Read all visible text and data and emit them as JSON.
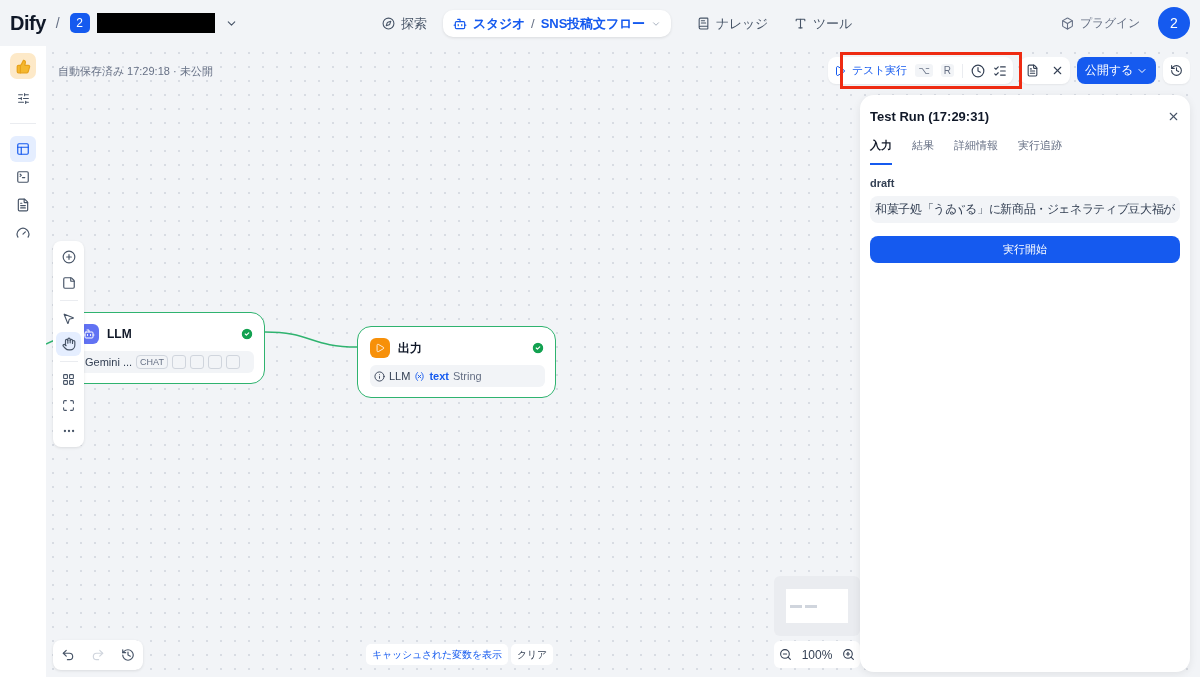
{
  "header": {
    "logo": "Dify",
    "separator": "/",
    "workspace_badge": "2",
    "nav": [
      {
        "label": "探索",
        "selected": false
      },
      {
        "label": "スタジオ",
        "selected": true,
        "separator": "/",
        "app": "SNS投稿文フロー"
      },
      {
        "label": "ナレッジ",
        "selected": false
      },
      {
        "label": "ツール",
        "selected": false
      }
    ],
    "plugin": "プラグイン",
    "avatar": "2"
  },
  "sidebar": {
    "items": [
      {
        "kind": "settings",
        "selected": false
      },
      {
        "kind": "editor",
        "selected": true
      },
      {
        "kind": "terminal",
        "selected": false
      },
      {
        "kind": "logs",
        "selected": false
      },
      {
        "kind": "monitor",
        "selected": false
      }
    ]
  },
  "status": "自動保存済み 17:29:18 · 未公開",
  "toolbar": {
    "test_run": "テスト実行",
    "shortcut": [
      "⌥",
      "R"
    ],
    "publish": "公開する"
  },
  "palette": [
    {
      "kind": "add",
      "selected": false
    },
    {
      "kind": "note",
      "selected": false
    },
    {
      "kind": "pointer",
      "selected": false
    },
    {
      "kind": "hand",
      "selected": true
    },
    {
      "kind": "organize",
      "selected": false
    },
    {
      "kind": "fit",
      "selected": false
    },
    {
      "kind": "more",
      "selected": false
    }
  ],
  "nodes": [
    {
      "kind": "llm",
      "title": "LLM",
      "done": true,
      "model": "Gemini ...",
      "tag": "CHAT"
    },
    {
      "kind": "output",
      "title": "出力",
      "done": true,
      "var_source": "LLM",
      "var_name": "text",
      "var_type": "String"
    }
  ],
  "bottom": {
    "show_cache": "キャッシュされた変数を表示",
    "clear": "クリア",
    "zoom": "100%"
  },
  "panel": {
    "title": "Test Run (17:29:31)",
    "tabs": [
      {
        "label": "入力",
        "selected": true
      },
      {
        "label": "結果",
        "selected": false
      },
      {
        "label": "詳細情報",
        "selected": false
      },
      {
        "label": "実行追跡",
        "selected": false
      }
    ],
    "field_label": "draft",
    "field_value": [
      "和菓子処「うゐ",
      "る」に新商品・ジェネラティブ豆大福が"
    ],
    "run_button": "実行開始"
  }
}
